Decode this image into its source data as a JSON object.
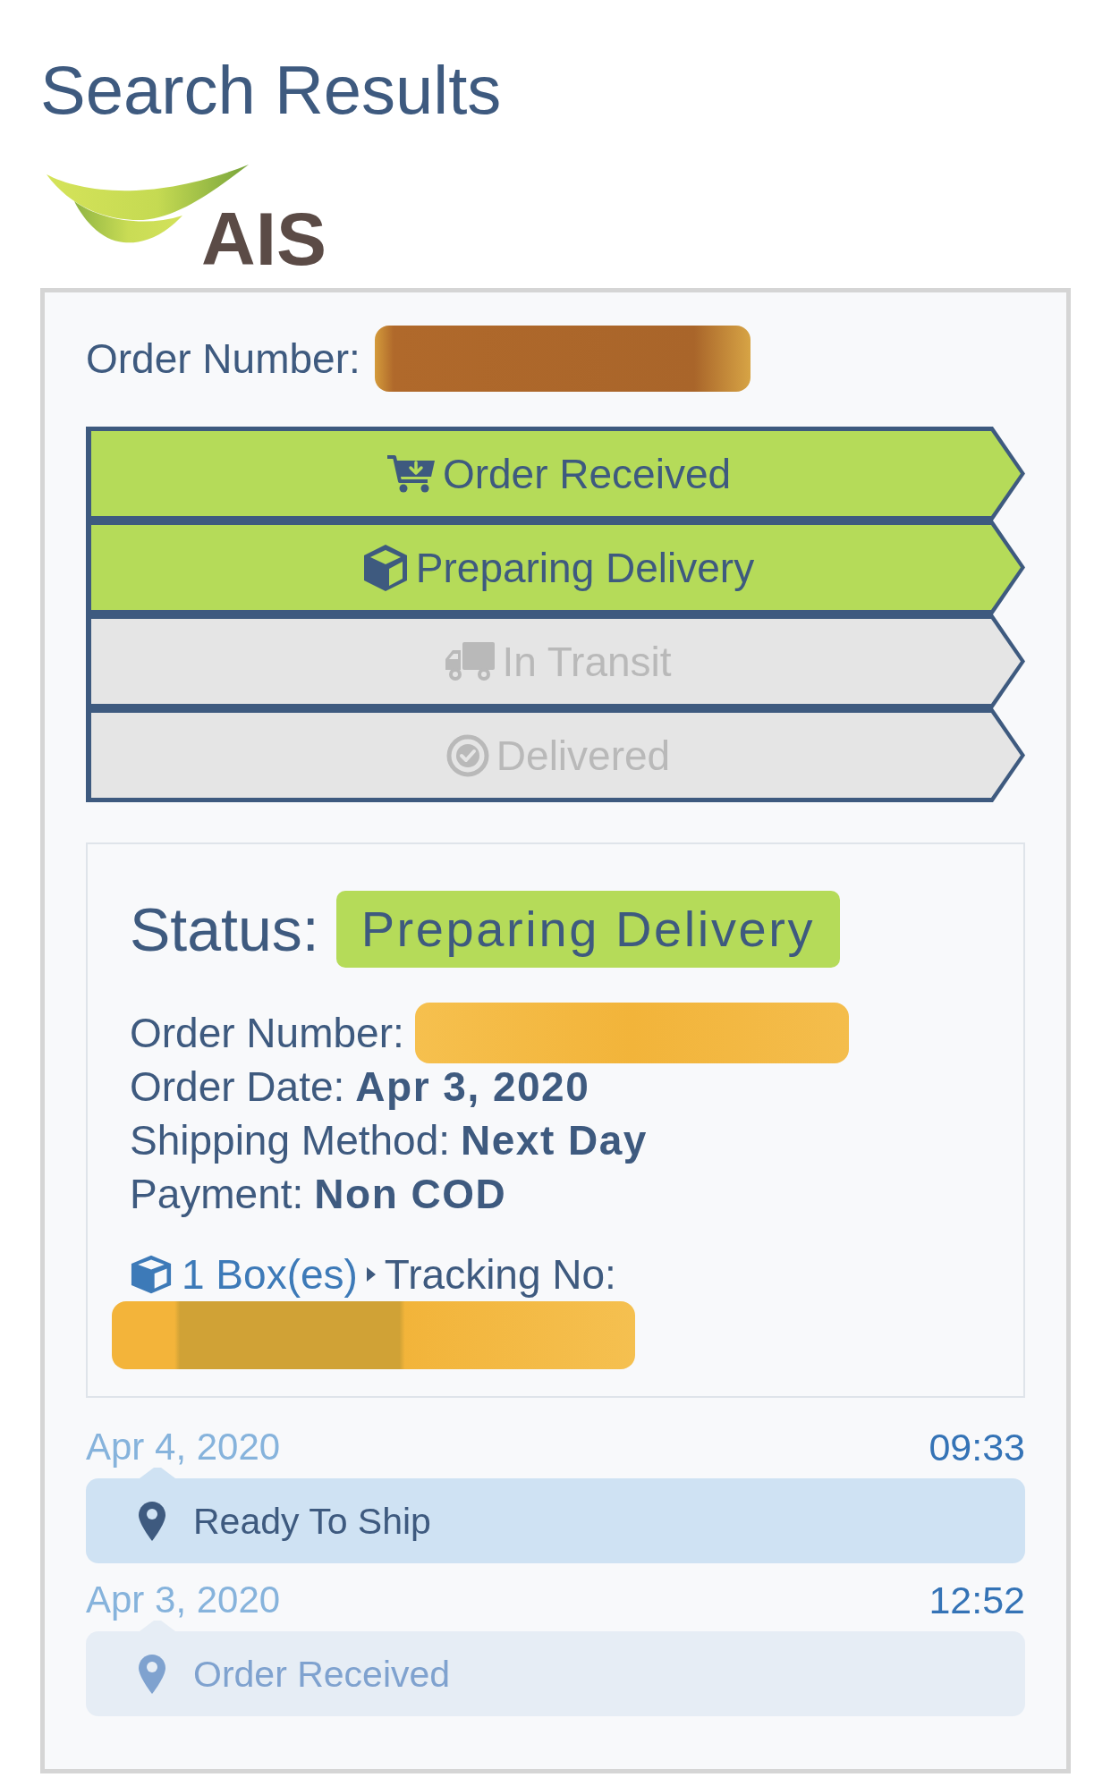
{
  "page": {
    "title": "Search Results"
  },
  "logo": {
    "text": "AIS"
  },
  "order": {
    "label": "Order Number:",
    "redacted": true
  },
  "steps": [
    {
      "kind": "cart",
      "label": "Order Received",
      "done": true
    },
    {
      "kind": "box",
      "label": "Preparing Delivery",
      "done": true
    },
    {
      "kind": "truck",
      "label": "In Transit",
      "done": false
    },
    {
      "kind": "check",
      "label": "Delivered",
      "done": false
    }
  ],
  "status": {
    "label": "Status:",
    "badge": "Preparing Delivery",
    "details": [
      {
        "label": "Order Number:",
        "redacted": true
      },
      {
        "label": "Order Date:",
        "value": "Apr 3, 2020",
        "redacted": false
      },
      {
        "label": "Shipping Method:",
        "value": "Next Day",
        "redacted": false
      },
      {
        "label": "Payment:",
        "value": "Non COD",
        "redacted": false
      }
    ],
    "tracking": {
      "boxes": "1 Box(es)",
      "label": "Tracking No:",
      "number_redacted": true
    }
  },
  "events": [
    {
      "date": "Apr 4, 2020",
      "time": "09:33",
      "text": "Ready To Ship",
      "current": true
    },
    {
      "date": "Apr 3, 2020",
      "time": "12:52",
      "text": "Order Received",
      "current": false
    }
  ]
}
